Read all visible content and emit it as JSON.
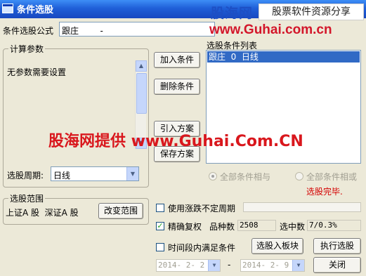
{
  "window": {
    "title": "条件选股"
  },
  "watermarks": {
    "top_logo": "股海网",
    "top_slogan": "股票软件资源分享",
    "top_url": "www.Guhai.com.cn",
    "middle": "股海网提供 www.Guhai.Com.CN"
  },
  "formula": {
    "label": "条件选股公式",
    "value": "跟庄        -"
  },
  "params": {
    "legend": "计算参数",
    "text": "无参数需要设置",
    "period_label": "选股周期:",
    "period_value": "日线"
  },
  "buttons": {
    "add": "加入条件",
    "delete": "删除条件",
    "import": "引入方案",
    "save": "保存方案",
    "change_range": "改变范围",
    "to_block": "选股入板块",
    "execute": "执行选股",
    "close": "关闭"
  },
  "conditions": {
    "title": "选股条件列表",
    "items": [
      "跟庄  0  日线"
    ],
    "all_and": "全部条件相与",
    "all_or": "全部条件相或",
    "status": "选股完毕."
  },
  "range": {
    "legend": "选股范围",
    "text": "上证A 股  深证A 股"
  },
  "options": {
    "use_undefined": "使用涨跌不定周期",
    "precise": "精确复权",
    "stock_count_label": "品种数",
    "stock_count": "2508",
    "selected_label": "选中数",
    "selected": "7/0.3%",
    "time_range": "时间段内满足条件",
    "date_from": "2014- 2- 2",
    "date_to": "2014- 2- 9",
    "dash": "-"
  },
  "colors": {
    "title_bar": "#1f5fd8",
    "status": "#d40000",
    "watermark": "#d9171d",
    "selection": "#316ac5"
  }
}
